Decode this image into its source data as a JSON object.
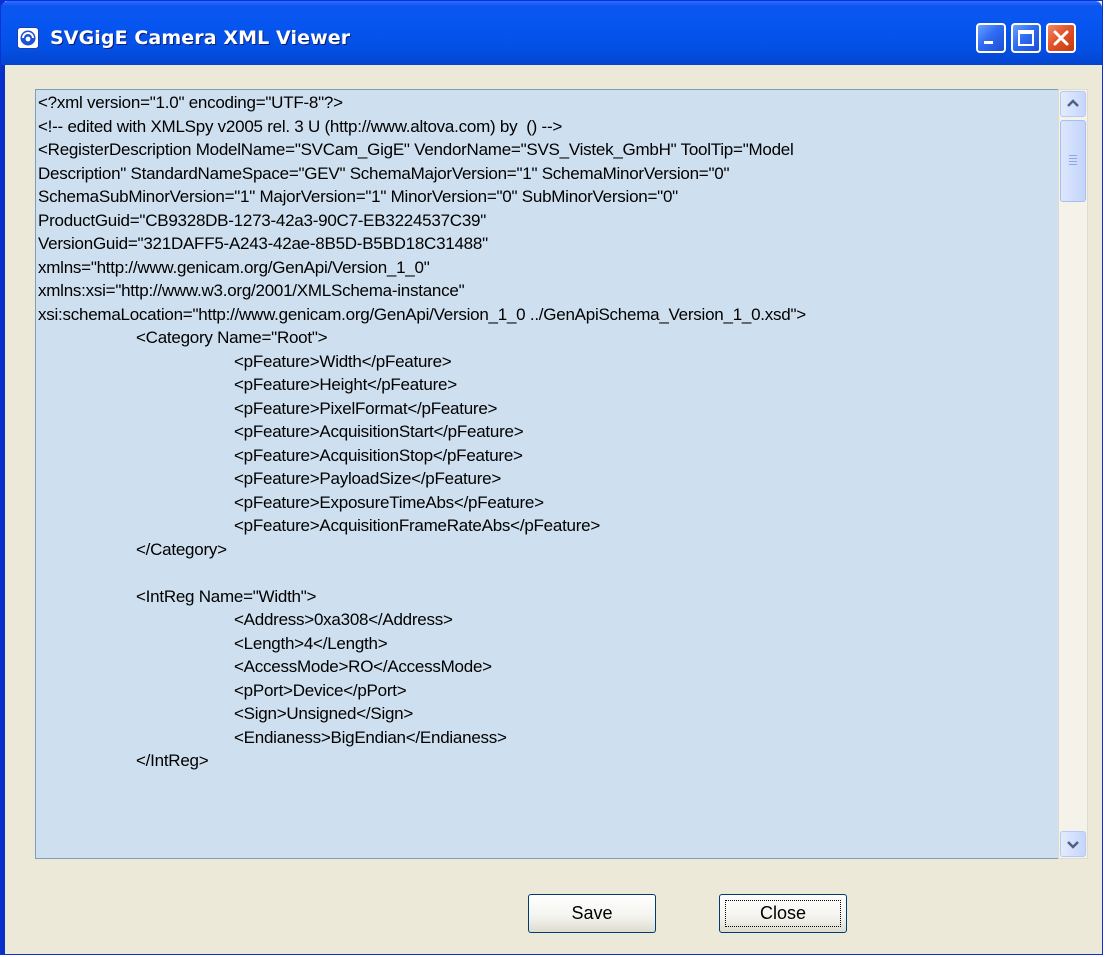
{
  "window": {
    "title": "SVGigE Camera XML Viewer"
  },
  "xml_lines": [
    {
      "indent": 0,
      "text": "<?xml version=\"1.0\" encoding=\"UTF-8\"?>"
    },
    {
      "indent": 0,
      "text": "<!-- edited with XMLSpy v2005 rel. 3 U (http://www.altova.com) by  () -->"
    },
    {
      "indent": 0,
      "text": "<RegisterDescription ModelName=\"SVCam_GigE\" VendorName=\"SVS_Vistek_GmbH\" ToolTip=\"Model"
    },
    {
      "indent": 0,
      "text": "Description\" StandardNameSpace=\"GEV\" SchemaMajorVersion=\"1\" SchemaMinorVersion=\"0\""
    },
    {
      "indent": 0,
      "text": "SchemaSubMinorVersion=\"1\" MajorVersion=\"1\" MinorVersion=\"0\" SubMinorVersion=\"0\""
    },
    {
      "indent": 0,
      "text": "ProductGuid=\"CB9328DB-1273-42a3-90C7-EB3224537C39\""
    },
    {
      "indent": 0,
      "text": "VersionGuid=\"321DAFF5-A243-42ae-8B5D-B5BD18C31488\""
    },
    {
      "indent": 0,
      "text": "xmlns=\"http://www.genicam.org/GenApi/Version_1_0\""
    },
    {
      "indent": 0,
      "text": "xmlns:xsi=\"http://www.w3.org/2001/XMLSchema-instance\""
    },
    {
      "indent": 0,
      "text": "xsi:schemaLocation=\"http://www.genicam.org/GenApi/Version_1_0 ../GenApiSchema_Version_1_0.xsd\">"
    },
    {
      "indent": 1,
      "text": "<Category Name=\"Root\">"
    },
    {
      "indent": 2,
      "text": "<pFeature>Width</pFeature>"
    },
    {
      "indent": 2,
      "text": "<pFeature>Height</pFeature>"
    },
    {
      "indent": 2,
      "text": "<pFeature>PixelFormat</pFeature>"
    },
    {
      "indent": 2,
      "text": "<pFeature>AcquisitionStart</pFeature>"
    },
    {
      "indent": 2,
      "text": "<pFeature>AcquisitionStop</pFeature>"
    },
    {
      "indent": 2,
      "text": "<pFeature>PayloadSize</pFeature>"
    },
    {
      "indent": 2,
      "text": "<pFeature>ExposureTimeAbs</pFeature>"
    },
    {
      "indent": 2,
      "text": "<pFeature>AcquisitionFrameRateAbs</pFeature>"
    },
    {
      "indent": 1,
      "text": "</Category>"
    },
    {
      "indent": 0,
      "text": ""
    },
    {
      "indent": 1,
      "text": "<IntReg Name=\"Width\">"
    },
    {
      "indent": 2,
      "text": "<Address>0xa308</Address>"
    },
    {
      "indent": 2,
      "text": "<Length>4</Length>"
    },
    {
      "indent": 2,
      "text": "<AccessMode>RO</AccessMode>"
    },
    {
      "indent": 2,
      "text": "<pPort>Device</pPort>"
    },
    {
      "indent": 2,
      "text": "<Sign>Unsigned</Sign>"
    },
    {
      "indent": 2,
      "text": "<Endianess>BigEndian</Endianess>"
    },
    {
      "indent": 1,
      "text": "</IntReg>"
    }
  ],
  "buttons": {
    "save": "Save",
    "close": "Close"
  },
  "icons": {
    "app": "svgige-app-icon",
    "minimize": "minimize-icon",
    "maximize": "maximize-icon",
    "close": "close-icon",
    "scroll_up": "chevron-up-icon",
    "scroll_down": "chevron-down-icon"
  },
  "colors": {
    "titlebar": "#0655f0",
    "text_background": "#cedfef",
    "dialog_background": "#ece9d8",
    "close_button": "#e2532a"
  }
}
